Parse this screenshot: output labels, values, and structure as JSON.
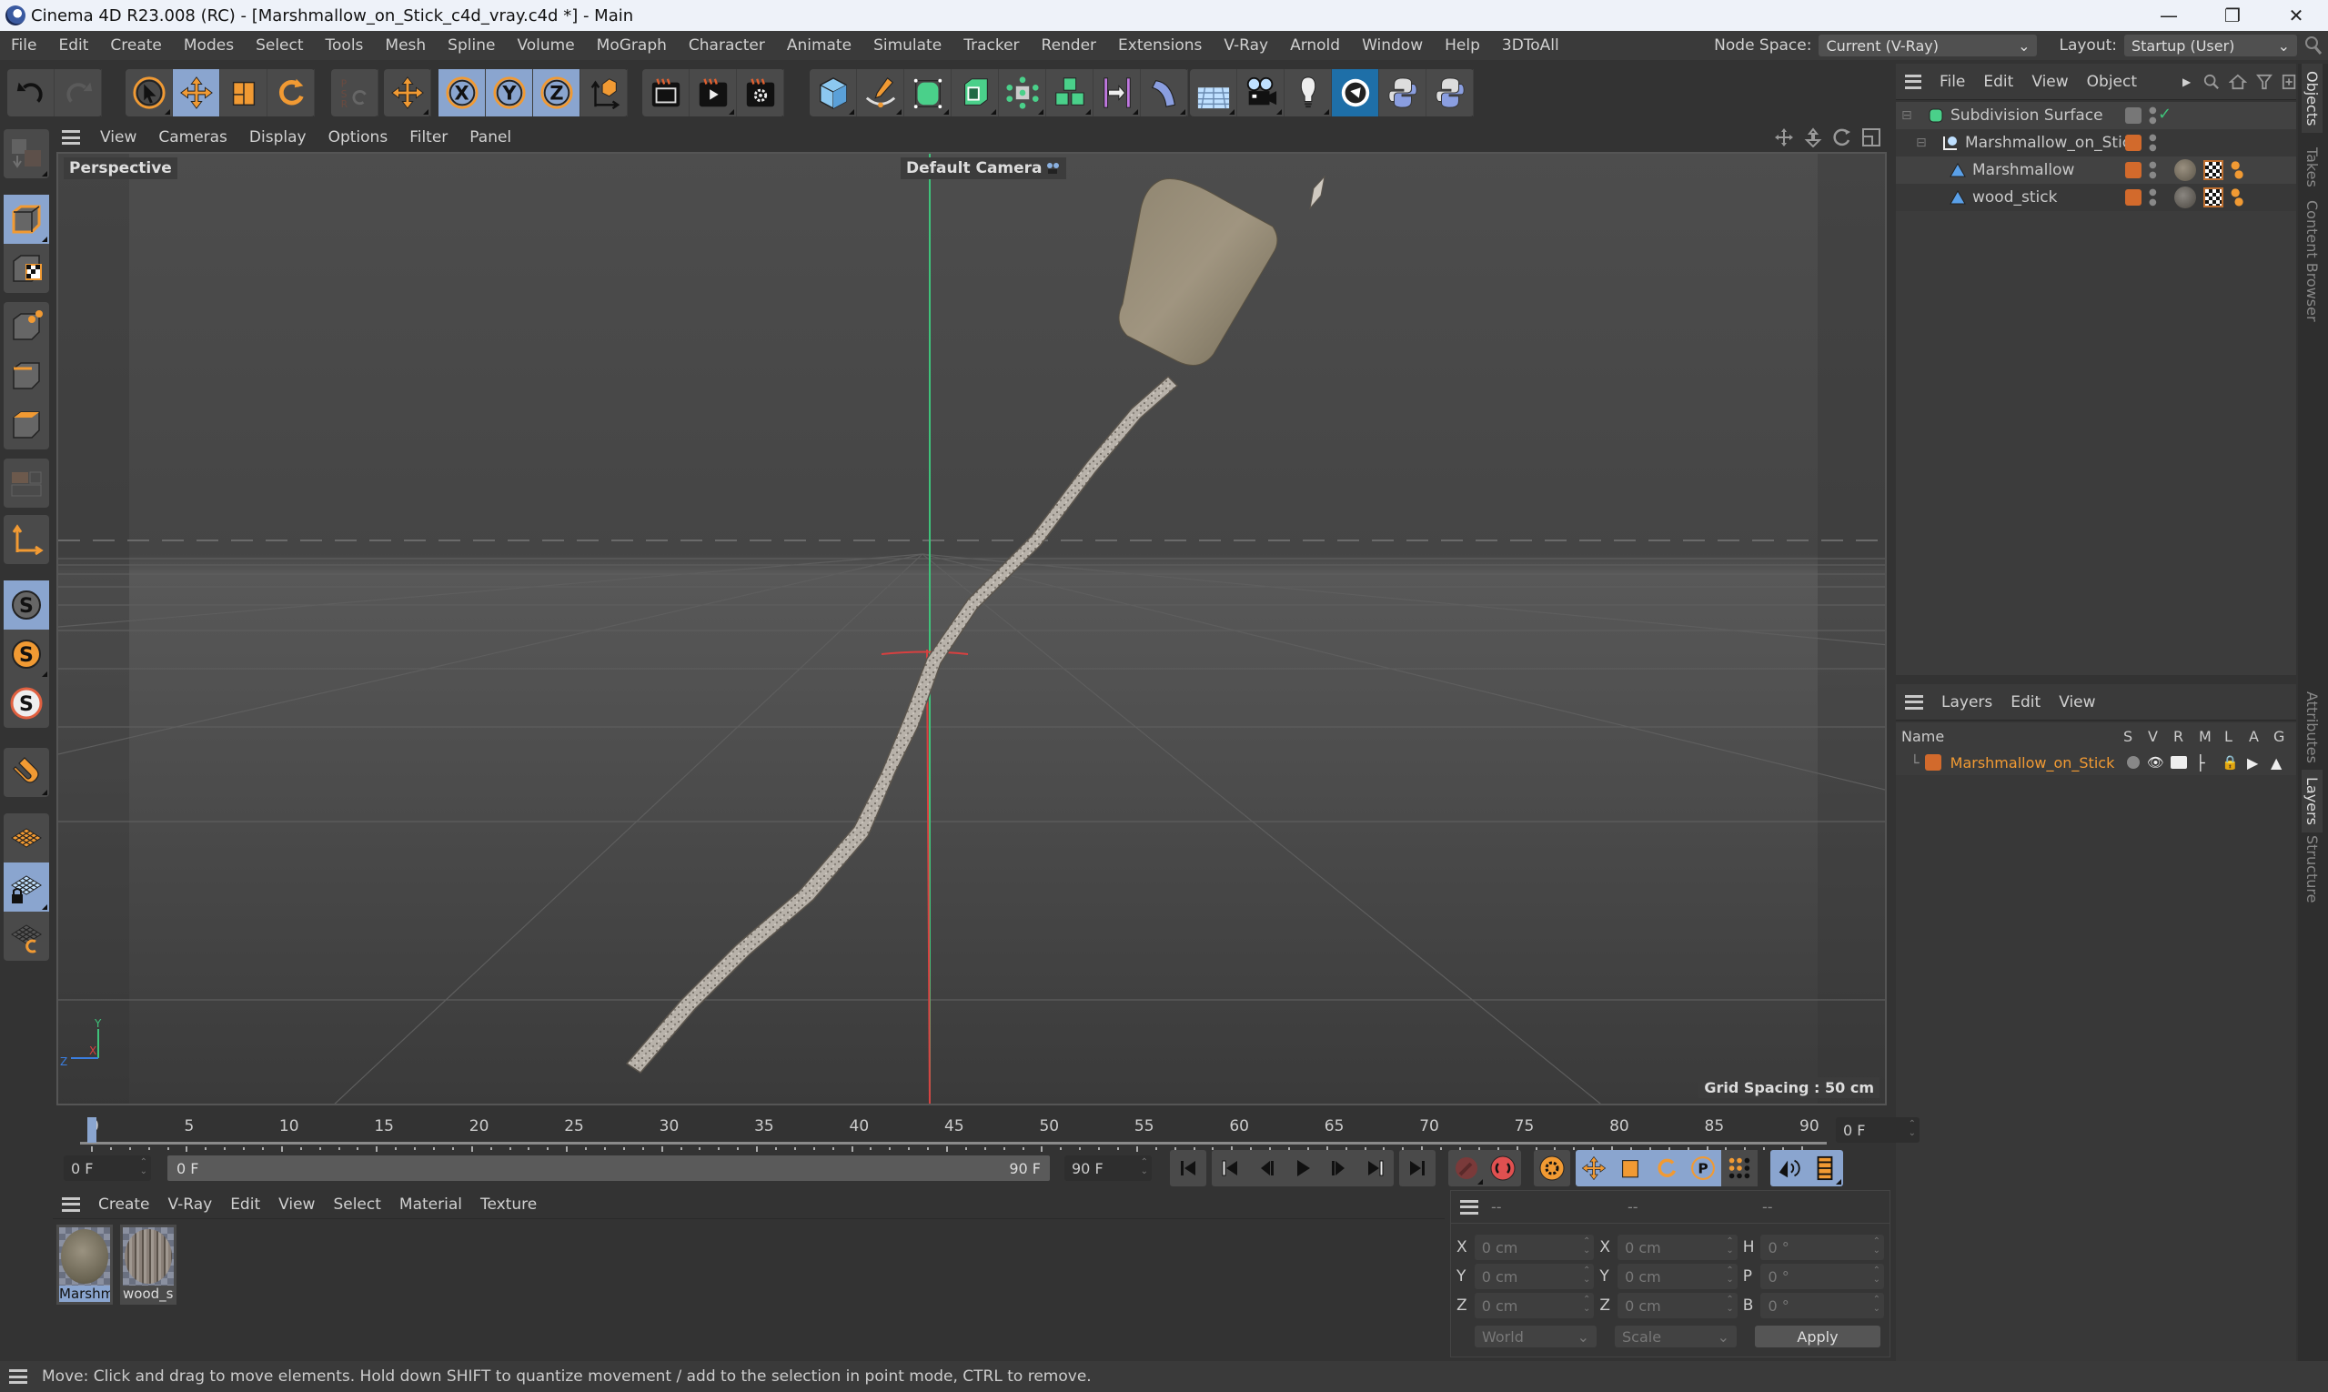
{
  "window": {
    "title": "Cinema 4D R23.008 (RC) - [Marshmallow_on_Stick_c4d_vray.c4d *] - Main",
    "controls": [
      "minimize",
      "restore",
      "close"
    ],
    "control_glyphs": [
      "—",
      "❐",
      "✕"
    ]
  },
  "menubar": {
    "items": [
      "File",
      "Edit",
      "Create",
      "Modes",
      "Select",
      "Tools",
      "Mesh",
      "Spline",
      "Volume",
      "MoGraph",
      "Character",
      "Animate",
      "Simulate",
      "Tracker",
      "Render",
      "Extensions",
      "V-Ray",
      "Arnold",
      "Window",
      "Help",
      "3DToAll"
    ],
    "node_space_label": "Node Space:",
    "node_space_value": "Current (V-Ray)",
    "layout_label": "Layout:",
    "layout_value": "Startup (User)"
  },
  "toolbar": {
    "groups": [
      [
        "undo",
        "redo"
      ],
      [
        "live-selection",
        "move",
        "scale",
        "rotate"
      ],
      [
        "psr-reset"
      ],
      [
        "move-axis"
      ],
      [
        "x-axis-lock",
        "y-axis-lock",
        "z-axis-lock",
        "coordinate-system"
      ],
      [
        "render-view",
        "render-picture-viewer",
        "render-settings"
      ],
      [
        "cube",
        "pen",
        "subdivision-surface",
        "extrude",
        "array",
        "cloner",
        "symmetry",
        "bend"
      ],
      [
        "floor",
        "camera",
        "light",
        "cinema4d-logo",
        "python",
        "python-alt"
      ]
    ],
    "active": [
      "move",
      "x-axis-lock",
      "y-axis-lock",
      "z-axis-lock"
    ]
  },
  "left_toolbar": {
    "items": [
      "make-editable",
      "model-mode",
      "texture-mode",
      "points-mode",
      "edges-mode",
      "polygons-mode",
      "uv-mode",
      "axis-mode",
      "snapping",
      "snap-settings",
      "solo",
      "magnet",
      "workplane",
      "locked-workplane",
      "workplane-align"
    ],
    "active": [
      "model-mode",
      "snapping",
      "locked-workplane"
    ]
  },
  "viewport": {
    "menu": [
      "View",
      "Cameras",
      "Display",
      "Options",
      "Filter",
      "Panel"
    ],
    "view_name": "Perspective",
    "camera_name": "Default Camera",
    "grid_spacing": "Grid Spacing : 50 cm",
    "axis_labels": {
      "x": "X",
      "y": "Y",
      "z": "Z"
    },
    "nav_icons": [
      "pan-icon",
      "dolly-icon",
      "orbit-icon",
      "maximize-view-icon"
    ]
  },
  "object_manager": {
    "menu": [
      "File",
      "Edit",
      "View",
      "Object"
    ],
    "objects": [
      {
        "name": "Subdivision Surface",
        "depth": 0,
        "icon": "subdivision-icon",
        "layer_color": "#777777",
        "enabled": true
      },
      {
        "name": "Marshmallow_on_Stick",
        "depth": 1,
        "icon": "null-icon",
        "layer_color": "#d26a2c"
      },
      {
        "name": "Marshmallow",
        "depth": 2,
        "icon": "polygon-icon",
        "layer_color": "#d26a2c",
        "material": "marshmallow"
      },
      {
        "name": "wood_stick",
        "depth": 2,
        "icon": "polygon-icon",
        "layer_color": "#d26a2c",
        "material": "wood"
      }
    ]
  },
  "side_tabs": {
    "top": [
      "Objects",
      "Takes",
      "Content Browser"
    ],
    "bottom": [
      "Attributes",
      "Layers",
      "Structure"
    ],
    "active_top": "Objects",
    "active_bottom": "Layers"
  },
  "layer_manager": {
    "menu": [
      "Layers",
      "Edit",
      "View"
    ],
    "columns": [
      "Name",
      "S",
      "V",
      "R",
      "M",
      "L",
      "A",
      "G"
    ],
    "layers": [
      {
        "name": "Marshmallow_on_Stick",
        "color": "#d26a2c"
      }
    ]
  },
  "timeline": {
    "ticks": [
      "0",
      "5",
      "10",
      "15",
      "20",
      "25",
      "30",
      "35",
      "40",
      "45",
      "50",
      "55",
      "60",
      "65",
      "70",
      "75",
      "80",
      "85",
      "90"
    ],
    "current_frame": 0,
    "max_frame": 90,
    "current_field": "0 F",
    "start_field": "0 F",
    "range_start": "0 F",
    "range_end": "90 F",
    "end_field": "90 F"
  },
  "material_manager": {
    "menu": [
      "Create",
      "V-Ray",
      "Edit",
      "View",
      "Select",
      "Material",
      "Texture"
    ],
    "materials": [
      {
        "name": "Marshm",
        "selected": true,
        "kind": "marshmallow"
      },
      {
        "name": "wood_st",
        "selected": false,
        "kind": "wood"
      }
    ]
  },
  "coordinates": {
    "headers": [
      "--",
      "--",
      "--"
    ],
    "position": [
      {
        "axis": "X",
        "value": "0 cm"
      },
      {
        "axis": "Y",
        "value": "0 cm"
      },
      {
        "axis": "Z",
        "value": "0 cm"
      }
    ],
    "size": [
      {
        "axis": "X",
        "value": "0 cm"
      },
      {
        "axis": "Y",
        "value": "0 cm"
      },
      {
        "axis": "Z",
        "value": "0 cm"
      }
    ],
    "rotation": [
      {
        "axis": "H",
        "value": "0 °"
      },
      {
        "axis": "P",
        "value": "0 °"
      },
      {
        "axis": "B",
        "value": "0 °"
      }
    ],
    "mode": "World",
    "size_mode": "Scale",
    "apply_label": "Apply"
  },
  "statusbar": {
    "text": "Move: Click and drag to move elements. Hold down SHIFT to quantize movement / add to the selection in point mode, CTRL to remove."
  },
  "colors": {
    "accent_orange": "#f19a33",
    "active_blue": "#8aa5cf",
    "layer_orange": "#d26a2c",
    "axis_x": "#d84040",
    "axis_y": "#3fc27a",
    "axis_z": "#3a7ee0"
  }
}
